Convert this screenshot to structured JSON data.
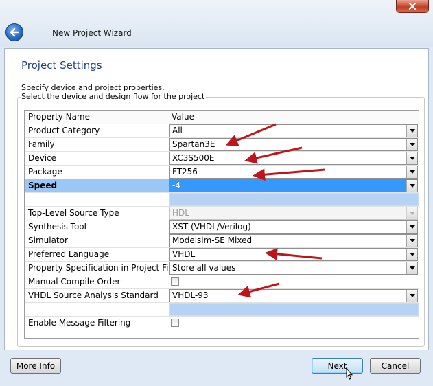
{
  "window": {
    "wizard_title": "New Project Wizard",
    "heading": "Project Settings",
    "description": "Specify device and project properties.",
    "group_title": "Select the device and design flow for the project"
  },
  "grid": {
    "columns": [
      "Property Name",
      "Value"
    ],
    "rows": [
      {
        "name": "Product Category",
        "value": "All",
        "type": "combo"
      },
      {
        "name": "Family",
        "value": "Spartan3E",
        "type": "combo"
      },
      {
        "name": "Device",
        "value": "XC3S500E",
        "type": "combo"
      },
      {
        "name": "Package",
        "value": "FT256",
        "type": "combo"
      },
      {
        "name": "Speed",
        "value": "-4",
        "type": "combo-selected"
      },
      {
        "name": "",
        "value": "",
        "type": "separator"
      },
      {
        "name": "Top-Level Source Type",
        "value": "HDL",
        "type": "combo-disabled"
      },
      {
        "name": "Synthesis Tool",
        "value": "XST (VHDL/Verilog)",
        "type": "combo"
      },
      {
        "name": "Simulator",
        "value": "Modelsim-SE Mixed",
        "type": "combo"
      },
      {
        "name": "Preferred Language",
        "value": "VHDL",
        "type": "combo"
      },
      {
        "name": "Property Specification in Project File",
        "value": "Store all values",
        "type": "combo"
      },
      {
        "name": "Manual Compile Order",
        "value": "",
        "type": "checkbox"
      },
      {
        "name": "VHDL Source Analysis Standard",
        "value": "VHDL-93",
        "type": "combo"
      },
      {
        "name": "",
        "value": "",
        "type": "separator"
      },
      {
        "name": "Enable Message Filtering",
        "value": "",
        "type": "checkbox"
      }
    ]
  },
  "buttons": {
    "more_info": "More Info",
    "next": "Next",
    "cancel": "Cancel"
  },
  "colors": {
    "heading": "#1e3f8e",
    "selection": "#3399ff",
    "separator": "#b7d3f3",
    "annotation_arrow": "#c0141b"
  },
  "icons": {
    "close": "close-x-icon",
    "back": "back-arrow-icon",
    "dropdown": "chevron-down-icon",
    "cursor": "mouse-pointer-icon"
  }
}
